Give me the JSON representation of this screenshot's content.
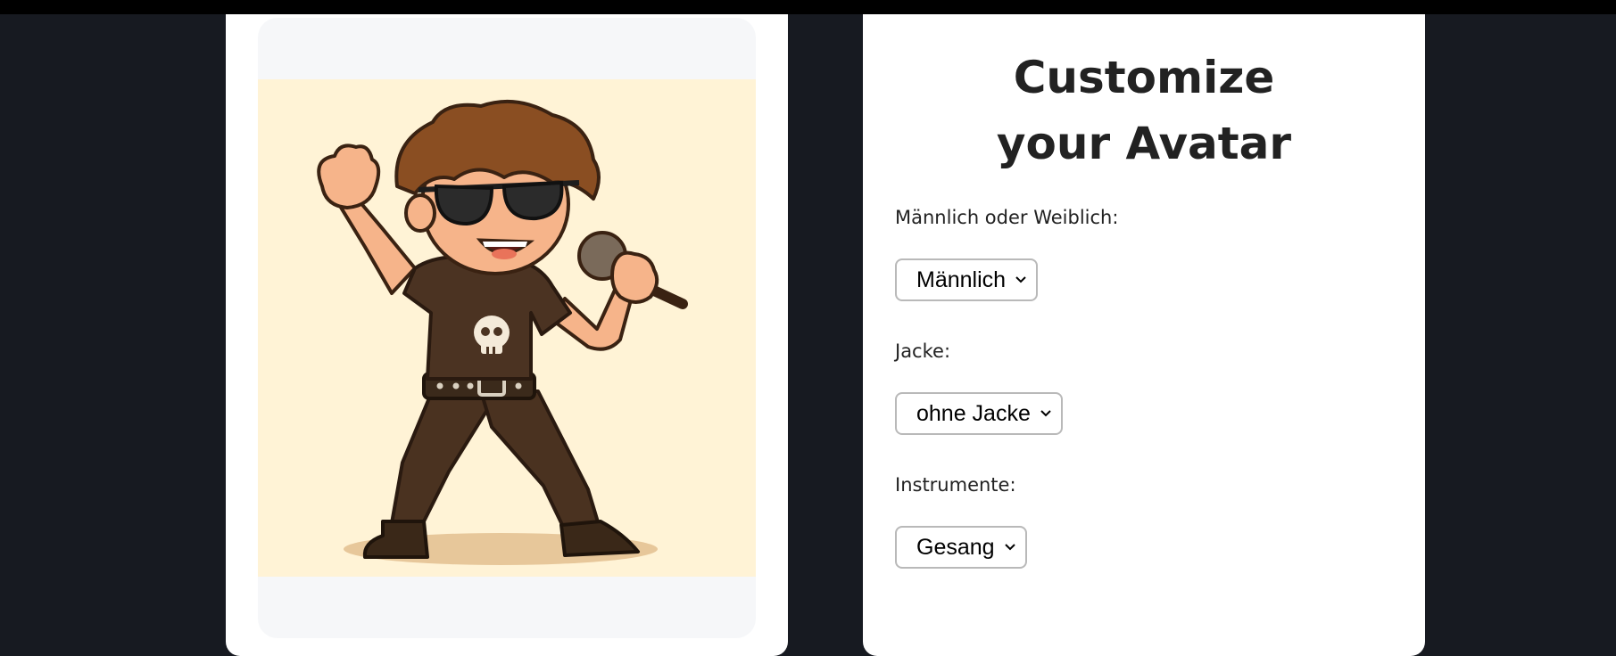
{
  "form": {
    "title": "Customize your Avatar",
    "fields": [
      {
        "label": "Männlich oder Weiblich:",
        "selected": "Männlich"
      },
      {
        "label": "Jacke:",
        "selected": "ohne Jacke"
      },
      {
        "label": "Instrumente:",
        "selected": "Gesang"
      }
    ]
  },
  "preview": {
    "image_alt": "Cartoon avatar singing with a microphone"
  },
  "icons": {
    "dropdown": "chevron-down-icon"
  },
  "colors": {
    "page_background": "#171a21",
    "card_background": "#ffffff",
    "image_background": "#fff3d6",
    "text": "#222222"
  }
}
